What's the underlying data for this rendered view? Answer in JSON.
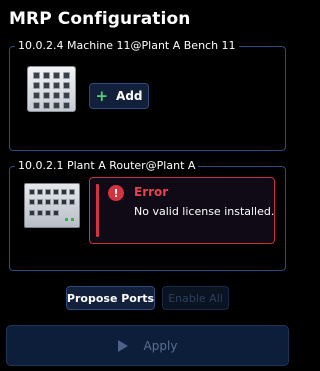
{
  "page": {
    "title": "MRP Configuration"
  },
  "devices": [
    {
      "label": "10.0.2.4 Machine 11@Plant A Bench 11",
      "image_icon": "switch-device-icon",
      "action": {
        "label": "Add",
        "icon": "plus-icon"
      }
    },
    {
      "label": "10.0.2.1 Plant A Router@Plant A",
      "image_icon": "router-device-icon",
      "error": {
        "icon": "exclamation-circle-icon",
        "title": "Error",
        "message": "No valid license installed."
      }
    }
  ],
  "actions": {
    "propose_ports": "Propose Ports",
    "enable_all": "Enable All",
    "apply": "Apply"
  },
  "colors": {
    "background": "#000000",
    "border": "#2b4a7d",
    "button_bg": "#12203b",
    "error": "#d33340",
    "add_plus": "#4fd16b",
    "disabled_text": "#2f3f5c"
  }
}
